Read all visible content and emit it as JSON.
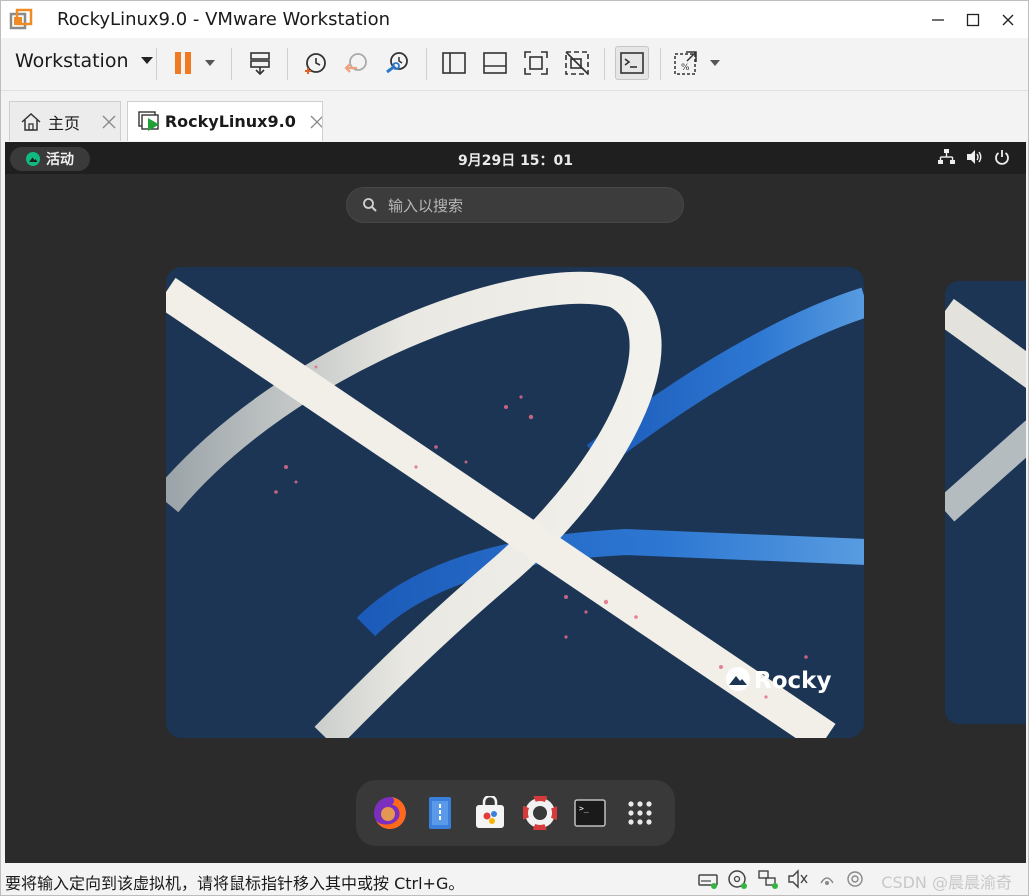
{
  "window": {
    "title": "RockyLinux9.0 - VMware Workstation"
  },
  "toolbar": {
    "workstation_menu": "Workstation"
  },
  "tabs": [
    {
      "label": "主页"
    },
    {
      "label": "RockyLinux9.0"
    }
  ],
  "guest": {
    "activities_label": "活动",
    "clock": "9月29日  15：01",
    "search_placeholder": "输入以搜索",
    "wallpaper_brand": "Rocky"
  },
  "statusbar": {
    "hint": "要将输入定向到该虚拟机，请将鼠标指针移入其中或按 Ctrl+G。",
    "watermark": "CSDN @晨晨渝奇"
  },
  "colors": {
    "pause_accent": "#f07a22",
    "rocky_green": "#10b981",
    "wallpaper_bg": "#1c3554"
  }
}
